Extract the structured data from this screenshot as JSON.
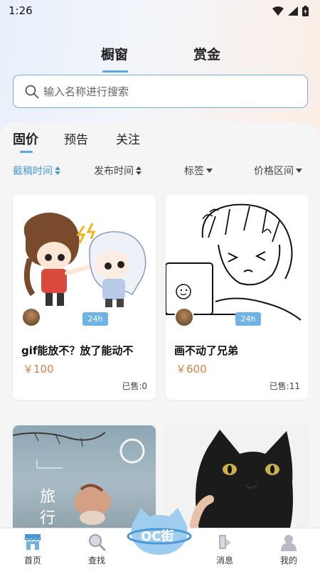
{
  "status": {
    "time": "1:26"
  },
  "top_tabs": [
    {
      "label": "橱窗"
    },
    {
      "label": "赏金"
    }
  ],
  "search": {
    "placeholder": "输入名称进行搜索"
  },
  "sub_tabs": [
    {
      "label": "固价"
    },
    {
      "label": "预告"
    },
    {
      "label": "关注"
    }
  ],
  "filters": [
    {
      "label": "截稿时间"
    },
    {
      "label": "发布时间"
    },
    {
      "label": "标签"
    },
    {
      "label": "价格区间"
    }
  ],
  "cards": [
    {
      "title": "gif能放不？放了能动不",
      "price": "￥100",
      "sold": "已售:0",
      "badge": "24h"
    },
    {
      "title": "画不动了兄弟",
      "price": "￥600",
      "sold": "已售:11",
      "badge": "24h"
    },
    {
      "art_text": "旅行"
    },
    {}
  ],
  "bottom_nav": [
    {
      "label": "首页"
    },
    {
      "label": "查找"
    },
    {
      "label": "消息"
    },
    {
      "label": "我的"
    }
  ],
  "logo_text": "OC街",
  "colors": {
    "accent": "#5aa6e6",
    "price": "#d5824a"
  }
}
